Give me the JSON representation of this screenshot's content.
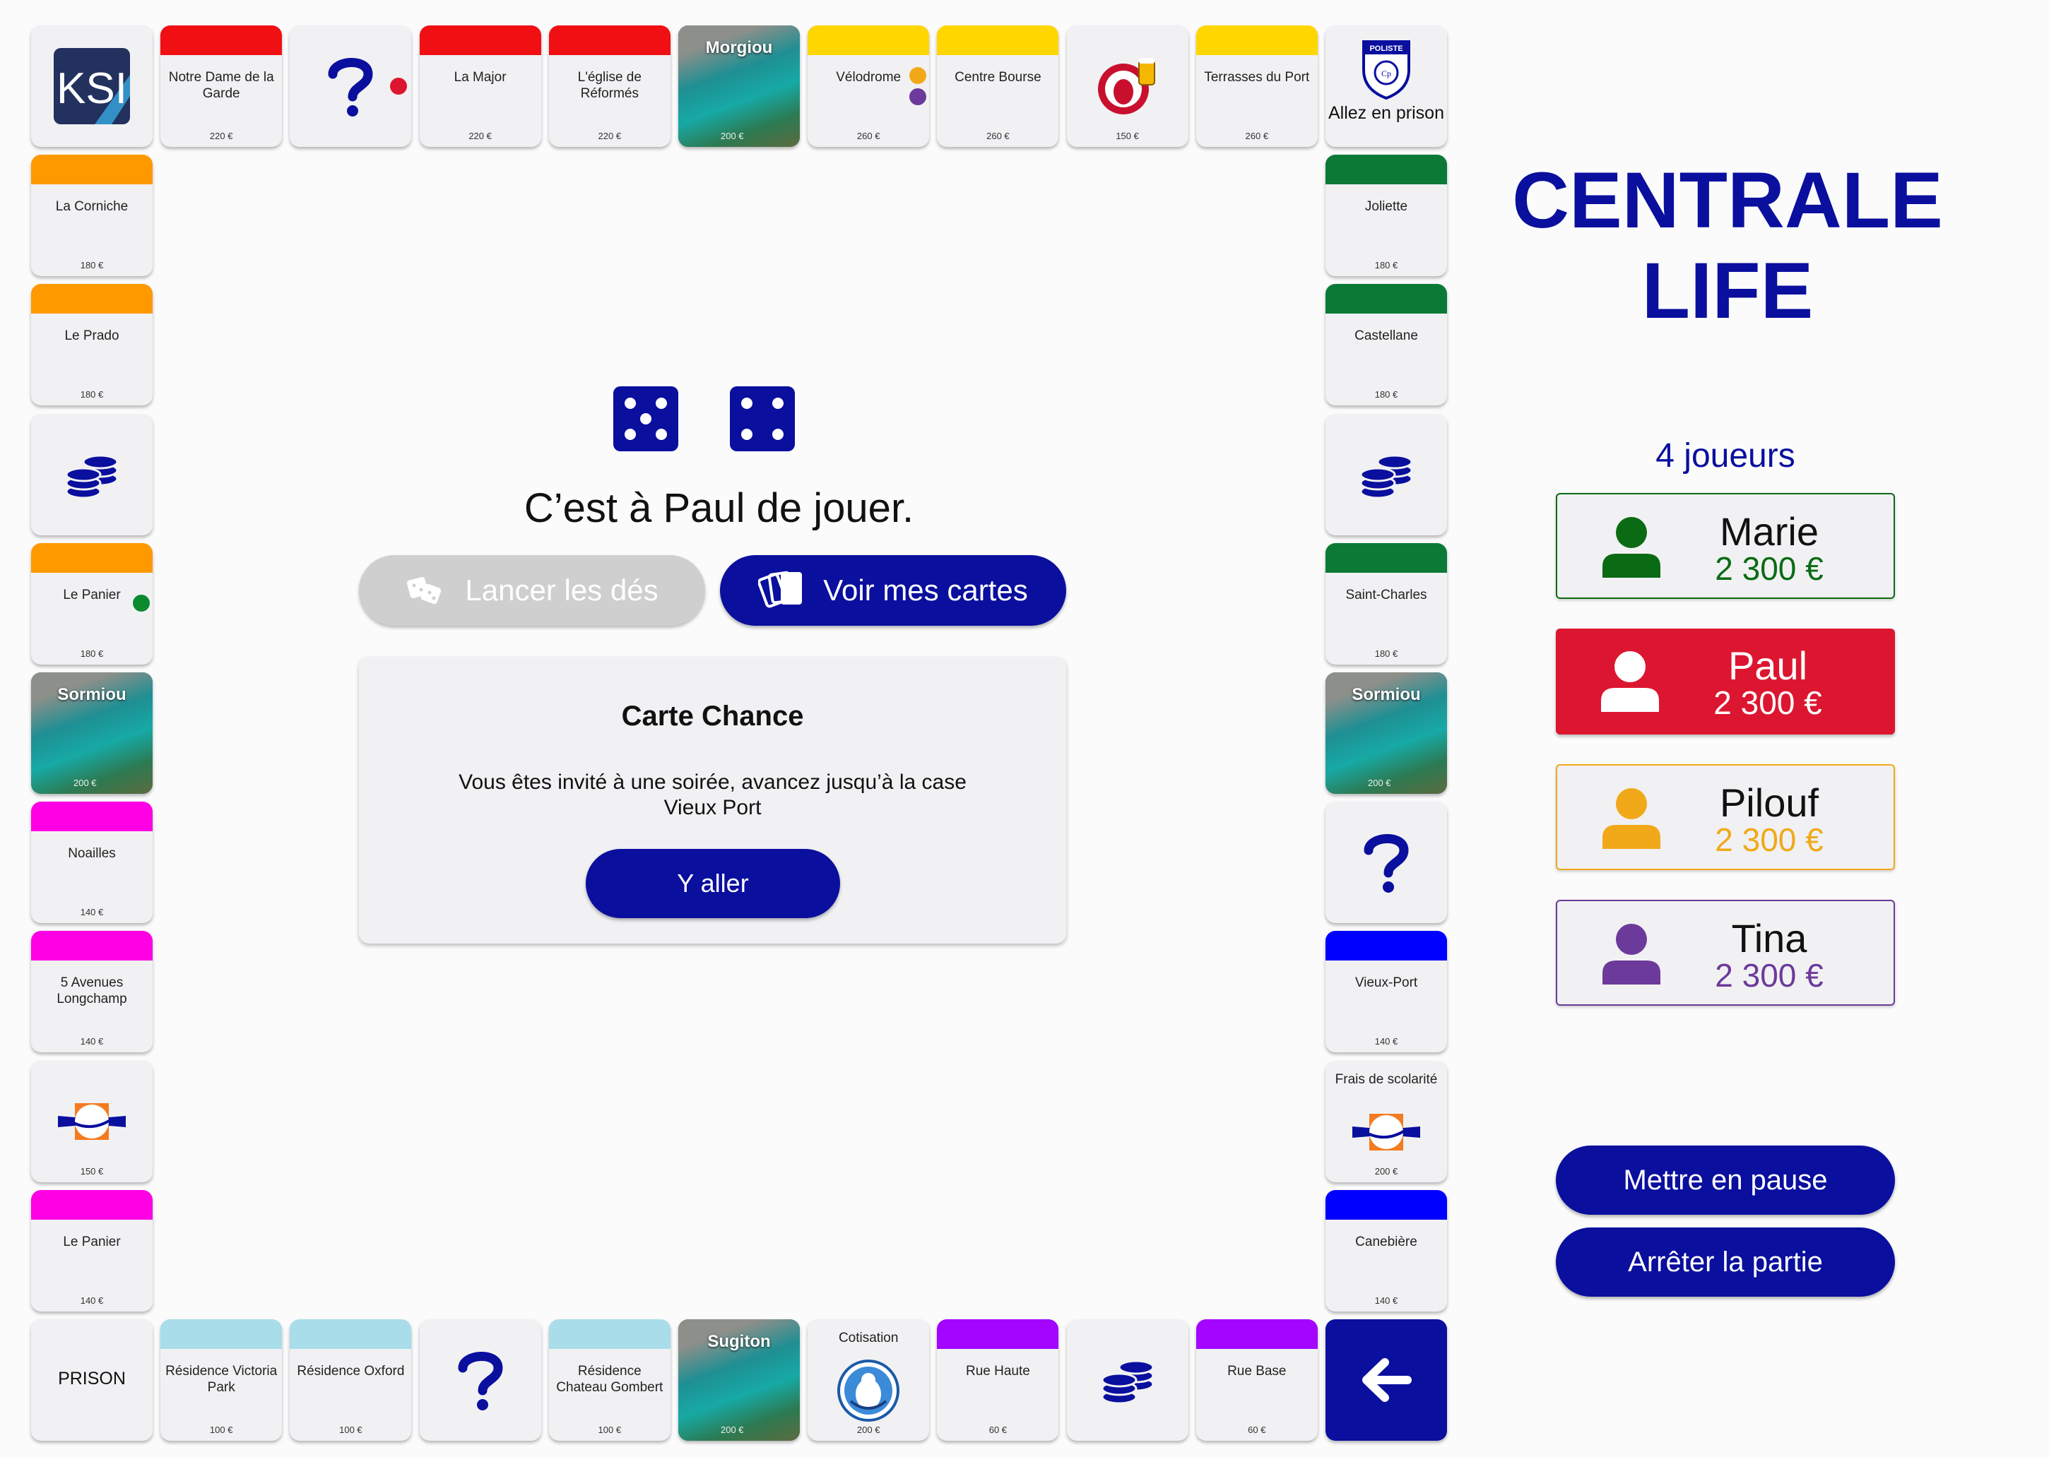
{
  "colors": {
    "navy": "#0a0f9e",
    "red": "#f00f12",
    "yellow": "#ffd600",
    "orange": "#ff9900",
    "green": "#0b7a36",
    "magenta": "#ff00e5",
    "blue": "#0000ff",
    "lightblue": "#a8dde9",
    "purple": "#a305ff",
    "player_green": "#0b6b14",
    "player_red": "#dc1630",
    "player_yellow": "#f1a91a",
    "player_purple": "#6c3a9b"
  },
  "board": {
    "top": [
      {
        "type": "logo",
        "icon": "ksi-logo",
        "label": "KSI"
      },
      {
        "type": "property",
        "band": "red",
        "name": "Notre Dame de la Garde",
        "price": "220 €"
      },
      {
        "type": "chance",
        "icon": "question-icon"
      },
      {
        "type": "property",
        "band": "red",
        "name": "La Major",
        "price": "220 €"
      },
      {
        "type": "property",
        "band": "red",
        "name": "L'église de Réformés",
        "price": "220 €"
      },
      {
        "type": "photo",
        "name": "Morgiou",
        "price": "200 €"
      },
      {
        "type": "property",
        "band": "yellow",
        "name": "Vélodrome",
        "price": "260 €"
      },
      {
        "type": "property",
        "band": "yellow",
        "name": "Centre Bourse",
        "price": "260 €"
      },
      {
        "type": "utility",
        "icon": "beer-mascot-icon",
        "price": "150 €"
      },
      {
        "type": "property",
        "band": "yellow",
        "name": "Terrasses du Port",
        "price": "260 €"
      },
      {
        "type": "corner",
        "icon": "police-badge-icon",
        "name": "Allez en prison"
      }
    ],
    "left": [
      {
        "type": "property",
        "band": "orange",
        "name": "La Corniche",
        "price": "180 €"
      },
      {
        "type": "property",
        "band": "orange",
        "name": "Le Prado",
        "price": "180 €"
      },
      {
        "type": "coins",
        "icon": "coins-icon"
      },
      {
        "type": "property",
        "band": "orange",
        "name": "Le Panier",
        "price": "180 €"
      },
      {
        "type": "photo",
        "name": "Sormiou",
        "price": "200 €"
      },
      {
        "type": "property",
        "band": "magenta",
        "name": "Noailles",
        "price": "140 €"
      },
      {
        "type": "property",
        "band": "magenta",
        "name": "5 Avenues Longchamp",
        "price": "140 €"
      },
      {
        "type": "utility",
        "icon": "planet-logo-icon",
        "price": "150 €"
      },
      {
        "type": "property",
        "band": "magenta",
        "name": "Le Panier",
        "price": "140 €"
      }
    ],
    "right": [
      {
        "type": "property",
        "band": "green",
        "name": "Joliette",
        "price": "180 €"
      },
      {
        "type": "property",
        "band": "green",
        "name": "Castellane",
        "price": "180 €"
      },
      {
        "type": "coins",
        "icon": "coins-icon"
      },
      {
        "type": "property",
        "band": "green",
        "name": "Saint-Charles",
        "price": "180 €"
      },
      {
        "type": "photo",
        "name": "Sormiou",
        "price": "200 €"
      },
      {
        "type": "chance",
        "icon": "question-icon"
      },
      {
        "type": "property",
        "band": "blue",
        "name": "Vieux-Port",
        "price": "140 €"
      },
      {
        "type": "tax",
        "icon": "planet-logo-icon",
        "name": "Frais de scolarité",
        "price": "200 €"
      },
      {
        "type": "property",
        "band": "blue",
        "name": "Canebière",
        "price": "140 €"
      }
    ],
    "bottom": [
      {
        "type": "corner",
        "name": "PRISON"
      },
      {
        "type": "property",
        "band": "lightblue",
        "name": "Résidence Victoria Park",
        "price": "100 €"
      },
      {
        "type": "property",
        "band": "lightblue",
        "name": "Résidence Oxford",
        "price": "100 €"
      },
      {
        "type": "chance",
        "icon": "question-icon"
      },
      {
        "type": "property",
        "band": "lightblue",
        "name": "Résidence Chateau Gombert",
        "price": "100 €"
      },
      {
        "type": "photo",
        "name": "Sugiton",
        "price": "200 €"
      },
      {
        "type": "tax",
        "icon": "club-logo-icon",
        "name": "Cotisation",
        "price": "200 €"
      },
      {
        "type": "property",
        "band": "purple",
        "name": "Rue Haute",
        "price": "60 €"
      },
      {
        "type": "coins",
        "icon": "coins-icon"
      },
      {
        "type": "property",
        "band": "purple",
        "name": "Rue Base",
        "price": "60 €"
      },
      {
        "type": "start",
        "icon": "arrow-left-icon"
      }
    ]
  },
  "center": {
    "dice": [
      5,
      4
    ],
    "turn_text": "C’est à Paul de jouer.",
    "roll_button": "Lancer les dés",
    "cards_button": "Voir mes cartes",
    "card": {
      "title": "Carte Chance",
      "text": "Vous êtes invité à une soirée, avancez jusqu’à la case Vieux Port",
      "action": "Y aller"
    }
  },
  "sidebar": {
    "title_line1": "CENTRALE",
    "title_line2": "LIFE",
    "player_count": "4 joueurs",
    "players": [
      {
        "name": "Marie",
        "money": "2 300 €",
        "color": "player_green",
        "active": false
      },
      {
        "name": "Paul",
        "money": "2 300 €",
        "color": "player_red",
        "active": true
      },
      {
        "name": "Pilouf",
        "money": "2 300 €",
        "color": "player_yellow",
        "active": false
      },
      {
        "name": "Tina",
        "money": "2 300 €",
        "color": "player_purple",
        "active": false
      }
    ],
    "pause_button": "Mettre en pause",
    "stop_button": "Arrêter la partie"
  }
}
